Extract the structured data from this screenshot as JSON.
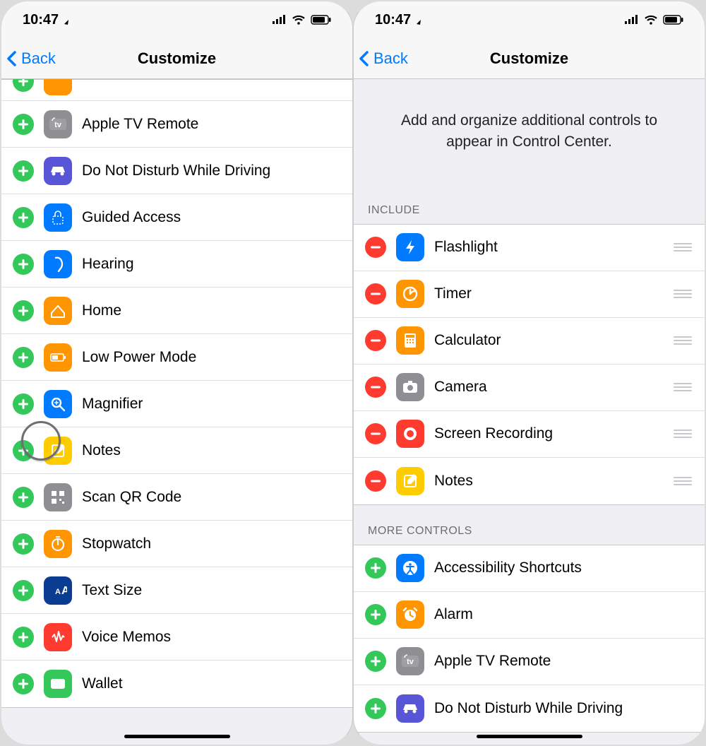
{
  "status": {
    "time": "10:47"
  },
  "nav": {
    "back": "Back",
    "title": "Customize"
  },
  "left": {
    "items": [
      {
        "label": ""
      },
      {
        "label": "Apple TV Remote"
      },
      {
        "label": "Do Not Disturb While Driving"
      },
      {
        "label": "Guided Access"
      },
      {
        "label": "Hearing"
      },
      {
        "label": "Home"
      },
      {
        "label": "Low Power Mode"
      },
      {
        "label": "Magnifier"
      },
      {
        "label": "Notes"
      },
      {
        "label": "Scan QR Code"
      },
      {
        "label": "Stopwatch"
      },
      {
        "label": "Text Size"
      },
      {
        "label": "Voice Memos"
      },
      {
        "label": "Wallet"
      }
    ]
  },
  "right": {
    "hero": "Add and organize additional controls to appear in Control Center.",
    "include_header": "Include",
    "include": [
      {
        "label": "Flashlight"
      },
      {
        "label": "Timer"
      },
      {
        "label": "Calculator"
      },
      {
        "label": "Camera"
      },
      {
        "label": "Screen Recording"
      },
      {
        "label": "Notes"
      }
    ],
    "more_header": "More Controls",
    "more": [
      {
        "label": "Accessibility Shortcuts"
      },
      {
        "label": "Alarm"
      },
      {
        "label": "Apple TV Remote"
      },
      {
        "label": "Do Not Disturb While Driving"
      }
    ]
  }
}
